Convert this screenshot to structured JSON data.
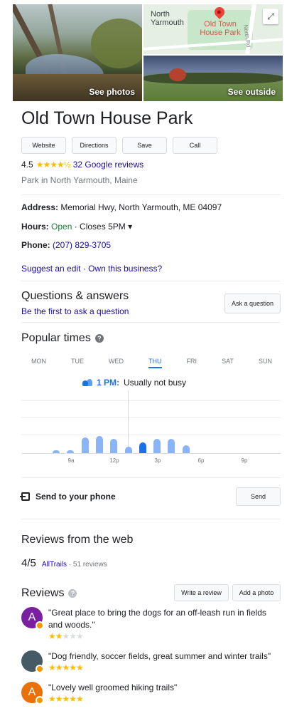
{
  "hero": {
    "see_photos": "See photos",
    "see_outside": "See outside",
    "map": {
      "town_label": "North Yarmouth",
      "park_label": "Old Town House Park",
      "road_label": "North Rd",
      "expand_icon": "expand-icon"
    }
  },
  "place": {
    "title": "Old Town House Park",
    "actions": [
      "Website",
      "Directions",
      "Save",
      "Call"
    ],
    "rating": "4.5",
    "stars": "★★★★½",
    "reviews_link": "32 Google reviews",
    "category": "Park in North Yarmouth, Maine"
  },
  "info": {
    "address_label": "Address:",
    "address": "Memorial Hwy, North Yarmouth, ME 04097",
    "hours_label": "Hours:",
    "hours_status": "Open",
    "hours_detail": "· Closes 5PM",
    "hours_caret": "▾",
    "phone_label": "Phone:",
    "phone": "(207) 829-3705",
    "suggest_edit": "Suggest an edit",
    "separator": "·",
    "own_business": "Own this business?"
  },
  "qa": {
    "title": "Questions & answers",
    "first_link": "Be the first to ask a question",
    "ask_button": "Ask a question"
  },
  "popular_times": {
    "title": "Popular times",
    "help_glyph": "?",
    "days": [
      "MON",
      "TUE",
      "WED",
      "THU",
      "FRI",
      "SAT",
      "SUN"
    ],
    "active_day": "THU",
    "current_time": "1 PM:",
    "current_status": "Usually not busy",
    "tick_labels": [
      "9a",
      "12p",
      "3p",
      "6p",
      "9p"
    ],
    "chart_data": {
      "type": "bar",
      "hours": [
        "7a",
        "8a",
        "9a",
        "10a",
        "11a",
        "12p",
        "1p",
        "2p",
        "3p",
        "4p"
      ],
      "values": [
        0.1,
        0.1,
        0.5,
        0.55,
        0.45,
        0.2,
        0.35,
        0.45,
        0.45,
        0.25
      ],
      "current_hour": "1p"
    }
  },
  "send": {
    "label": "Send to your phone",
    "button": "Send"
  },
  "web_reviews": {
    "title": "Reviews from the web",
    "score": "4/5",
    "source": "AllTrails",
    "count": "· 51 reviews"
  },
  "reviews": {
    "title": "Reviews",
    "help_glyph": "?",
    "write_button": "Write a review",
    "photo_button": "Add a photo",
    "items": [
      {
        "avatar_letter": "A",
        "avatar_color": "#7b1fa2",
        "text": "\"Great place to bring the dogs for an off-leash run in fields and woods.\"",
        "stars_on": "★★",
        "stars_off": "★★★"
      },
      {
        "avatar_letter": "",
        "avatar_color": "#455a64",
        "text": "\"Dog friendly, soccer fields, great summer and winter trails\"",
        "stars_on": "★★★★★",
        "stars_off": ""
      },
      {
        "avatar_letter": "A",
        "avatar_color": "#e8710a",
        "text": "\"Lovely well groomed hiking trails\"",
        "stars_on": "★★★★★",
        "stars_off": ""
      }
    ]
  },
  "colors": {
    "link": "#1a0dab",
    "accent": "#1a73e8",
    "star": "#fbbc04",
    "open": "#188038"
  }
}
